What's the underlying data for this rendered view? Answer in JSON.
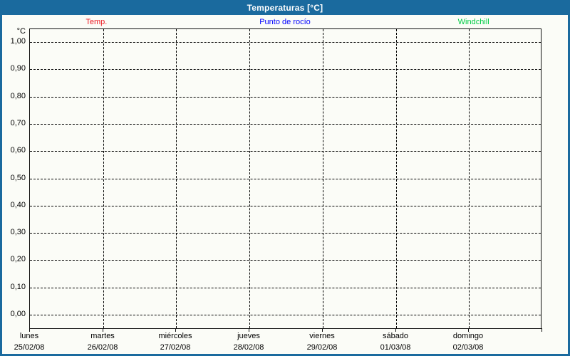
{
  "window": {
    "title": "Temperaturas [°C]"
  },
  "colors": {
    "frame_blue": "#1A6A9E",
    "title_text": "#FFFFFF",
    "background": "#FBFCF7",
    "grid": "#000000",
    "temp_red": "#ED1C24",
    "dew_point_blue": "#0000FF",
    "windchill_green": "#00CC44"
  },
  "legend": {
    "items": [
      {
        "label": "Temp.",
        "color": "#ED1C24"
      },
      {
        "label": "Punto de rocío",
        "color": "#0000FF"
      },
      {
        "label": "Windchill",
        "color": "#00CC44"
      }
    ]
  },
  "y_axis": {
    "unit": "°C",
    "tick_labels": [
      "1,00",
      "0,90",
      "0,80",
      "0,70",
      "0,60",
      "0,50",
      "0,40",
      "0,30",
      "0,20",
      "0,10",
      "0,00"
    ]
  },
  "x_axis": {
    "days": [
      {
        "name": "lunes",
        "date": "25/02/08"
      },
      {
        "name": "martes",
        "date": "26/02/08"
      },
      {
        "name": "miércoles",
        "date": "27/02/08"
      },
      {
        "name": "jueves",
        "date": "28/02/08"
      },
      {
        "name": "viernes",
        "date": "29/02/08"
      },
      {
        "name": "sábado",
        "date": "01/03/08"
      },
      {
        "name": "domingo",
        "date": "02/03/08"
      }
    ]
  },
  "chart_data": {
    "type": "line",
    "title": "Temperaturas [°C]",
    "ylabel": "°C",
    "ylim": [
      0.0,
      1.0
    ],
    "y_tick_step": 0.1,
    "grid": true,
    "grid_style": "dashed",
    "legend_position": "top",
    "categories": [
      "lunes 25/02/08",
      "martes 26/02/08",
      "miércoles 27/02/08",
      "jueves 28/02/08",
      "viernes 29/02/08",
      "sábado 01/03/08",
      "domingo 02/03/08"
    ],
    "series": [
      {
        "name": "Temp.",
        "color": "#ED1C24",
        "values": []
      },
      {
        "name": "Punto de rocío",
        "color": "#0000FF",
        "values": []
      },
      {
        "name": "Windchill",
        "color": "#00CC44",
        "values": []
      }
    ]
  }
}
